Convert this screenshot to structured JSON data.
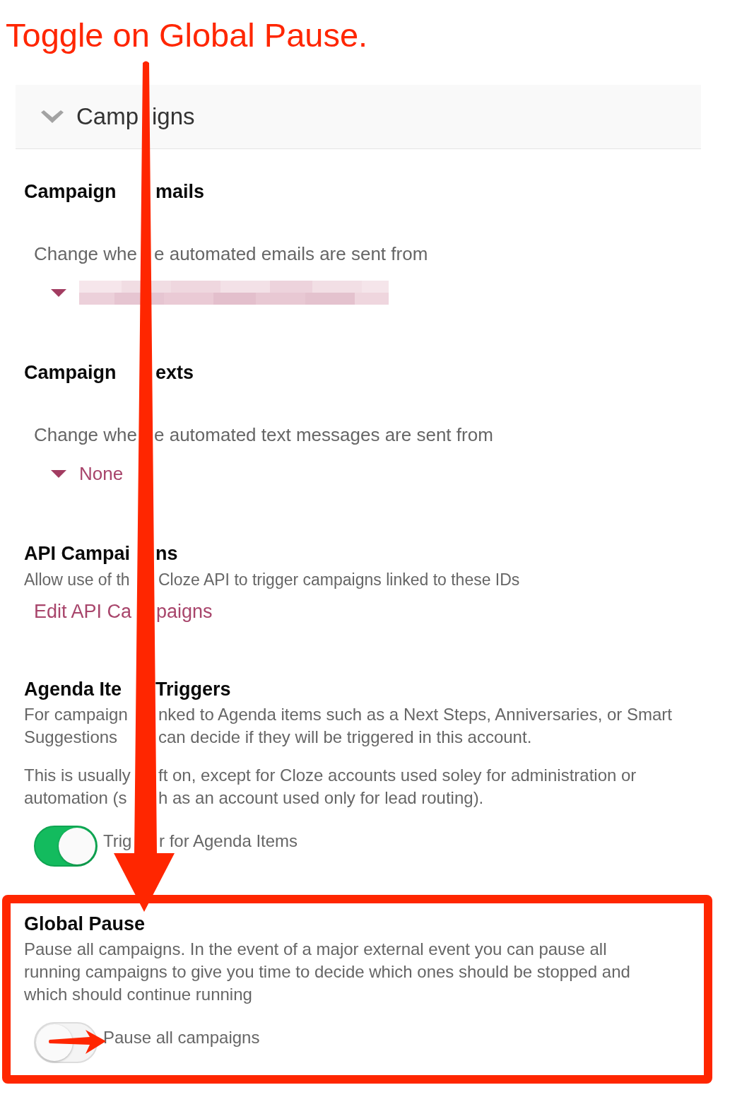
{
  "annotation": {
    "caption": "Toggle on Global Pause."
  },
  "panel": {
    "title": [
      "Camp",
      "igns"
    ],
    "expanded": true
  },
  "sections": [
    {
      "title": [
        "Campaign",
        "mails"
      ],
      "kind": "select",
      "highlighted": false,
      "paragraphs": [
        {
          "lines": [
            [
              "Change whe",
              "e automated emails are sent from"
            ]
          ]
        }
      ],
      "select": {
        "redacted": true
      }
    },
    {
      "title": [
        "Campaign",
        "exts"
      ],
      "kind": "select",
      "highlighted": false,
      "paragraphs": [
        {
          "lines": [
            [
              "Change whe",
              "e automated text messages are sent from"
            ]
          ]
        }
      ],
      "select": {
        "redacted": false,
        "value": "None"
      }
    },
    {
      "title": [
        "API Campai",
        "ns"
      ],
      "kind": "link",
      "highlighted": false,
      "paragraphs": [
        {
          "lines": [
            [
              "Allow use of th",
              "Cloze API to trigger campaigns linked to these IDs"
            ]
          ]
        }
      ],
      "link": [
        "Edit API Ca",
        "paigns"
      ]
    },
    {
      "title": [
        "Agenda Ite",
        "Triggers"
      ],
      "kind": "toggle",
      "highlighted": false,
      "paragraphs": [
        {
          "lines": [
            [
              "For campaign",
              "nked to Agenda items such as a Next Steps, Anniversaries, or Smart"
            ],
            [
              "Suggestions",
              "can decide if they will be triggered in this account."
            ]
          ]
        },
        {
          "lines": [
            [
              "This is usually",
              "ft on, except for Cloze accounts used soley for administration or"
            ],
            [
              "automation (s",
              "h as an account used only for lead routing)."
            ]
          ]
        }
      ],
      "toggle": {
        "label": [
          "Trig",
          "r for Agenda Items"
        ],
        "on": true
      }
    },
    {
      "title": [
        "Global Pause"
      ],
      "kind": "toggle",
      "highlighted": true,
      "paragraphs": [
        {
          "text": "Pause all campaigns. In the event of a major external event you can pause all running campaigns to give you time to decide which ones should be stopped and which should continue running"
        }
      ],
      "toggle": {
        "label": [
          "Pause all campaigns"
        ],
        "on": false
      }
    }
  ]
}
